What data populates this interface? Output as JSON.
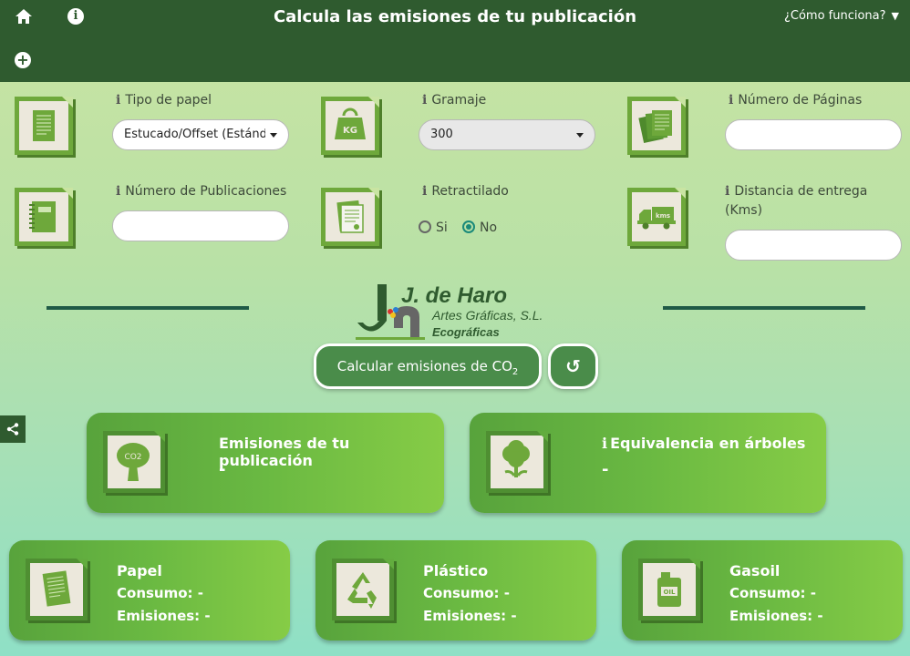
{
  "header": {
    "title": "Calcula las emisiones de tu publicación",
    "how_it_works": "¿Cómo funciona?",
    "info_glyph": "i",
    "plus_glyph": "+"
  },
  "fields": {
    "paper_type": {
      "label": "Tipo de papel",
      "value": "Estucado/Offset (Estándar)"
    },
    "grammage": {
      "label": "Gramaje",
      "value": "300"
    },
    "pages": {
      "label": "Número de Páginas",
      "value": ""
    },
    "publications": {
      "label": "Número de Publicaciones",
      "value": ""
    },
    "shrink_wrap": {
      "label": "Retractilado",
      "options": [
        "Si",
        "No"
      ],
      "selected": "No"
    },
    "distance": {
      "label": "Distancia de entrega (Kms)",
      "value": ""
    }
  },
  "logo": {
    "name": "J. de Haro",
    "subtitle": "Artes Gráficas, S.L.",
    "tagline": "Ecográficas"
  },
  "actions": {
    "calculate_text": "Calcular emisiones de CO",
    "calculate_sub": "2"
  },
  "results": {
    "publication": {
      "title": "Emisiones de tu publicación",
      "value": "-"
    },
    "trees": {
      "title": "Equivalencia en árboles",
      "value": "-"
    }
  },
  "breakdown": {
    "paper": {
      "title": "Papel",
      "consumption": "Consumo: -",
      "emissions": "Emisiones: -"
    },
    "plastic": {
      "title": "Plástico",
      "consumption": "Consumo: -",
      "emissions": "Emisiones: -"
    },
    "diesel": {
      "title": "Gasoil",
      "consumption": "Consumo: -",
      "emissions": "Emisiones: -"
    }
  },
  "icon_text": {
    "weight": "KG",
    "truck": "kms",
    "co2": "CO2",
    "oil": "OIL"
  },
  "colors": {
    "header": "#2f5b2f",
    "accent": "#6ea83b",
    "button": "#4a8c4a",
    "radio": "#1a8a7a"
  }
}
